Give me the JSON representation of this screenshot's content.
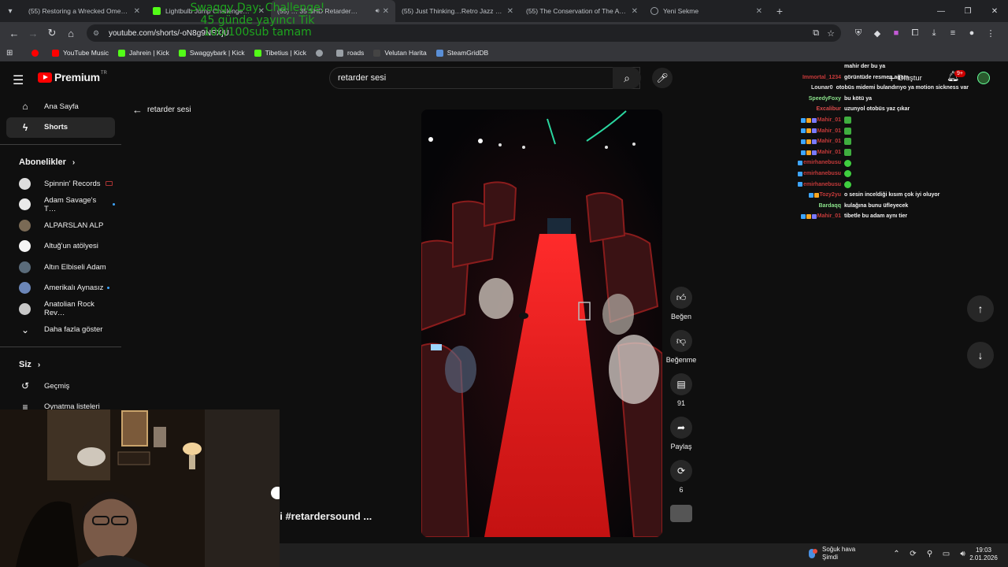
{
  "browser": {
    "tabs": [
      {
        "title": "(55) Restoring a Wrecked Ome…",
        "icon": "youtube",
        "active": false
      },
      {
        "title": "Lightbulb Jump Challenge…",
        "icon": "kick",
        "active": false
      },
      {
        "title": "(55) … 35 SHD Retarder…",
        "icon": "youtube",
        "active": true,
        "audio": true
      },
      {
        "title": "(55) Just Thinking…Retro Jazz …",
        "icon": "youtube",
        "active": false
      },
      {
        "title": "(55) The Conservation of The A…",
        "icon": "youtube",
        "active": false
      },
      {
        "title": "Yeni Sekme",
        "icon": "globe",
        "active": false
      }
    ],
    "url": "youtube.com/shorts/-oN8g9NSXjU",
    "bookmarks": [
      {
        "label": "YouTube Music",
        "color": "#ff0000"
      },
      {
        "label": "Jahrein | Kick",
        "color": "#53fc18"
      },
      {
        "label": "Swaggybark | Kick",
        "color": "#53fc18"
      },
      {
        "label": "Tibetius | Kick",
        "color": "#53fc18"
      },
      {
        "label": "",
        "color": "#9aa0a6"
      },
      {
        "label": "roads",
        "color": "#9aa0a6"
      },
      {
        "label": "Velutan Harita",
        "color": "#444444"
      },
      {
        "label": "SteamGridDB",
        "color": "#5a8fd6"
      }
    ]
  },
  "overlay": {
    "line1": "Swaggy Day: Challenge!",
    "line2": "45 günde yayıncı Tik",
    "line3": "100/100sub tamam"
  },
  "yt": {
    "brand": "Premium",
    "brand_sup": "TR",
    "search_query": "retarder sesi",
    "create_label": "Oluştur",
    "notif_count": "9+",
    "back_label": "retarder sesi",
    "sidebar": {
      "home": "Ana Sayfa",
      "shorts": "Shorts",
      "subs_header": "Abonelikler",
      "subs": [
        {
          "label": "Spinnin' Records",
          "color": "#dddddd",
          "extra": "live"
        },
        {
          "label": "Adam Savage's T…",
          "color": "#e9e9e9",
          "extra": "dot"
        },
        {
          "label": "ALPARSLAN ALP",
          "color": "#7a6a55",
          "extra": ""
        },
        {
          "label": "Altuğ'un atölyesi",
          "color": "#f5f5f5",
          "extra": ""
        },
        {
          "label": "Altın Elbiseli Adam",
          "color": "#5a6b7a",
          "extra": ""
        },
        {
          "label": "Amerikalı Aynasız",
          "color": "#6b86b8",
          "extra": "dot"
        },
        {
          "label": "Anatolian Rock Rev…",
          "color": "#c7c7c7",
          "extra": ""
        }
      ],
      "more": "Daha fazla göster",
      "you_header": "Siz",
      "history": "Geçmiş",
      "playlists": "Oynatma listeleri"
    },
    "actions": {
      "like": "Beğen",
      "dislike": "Beğenme",
      "comments": "91",
      "share": "Paylaş",
      "remix": "6"
    },
    "short_title": "si #retardersound ..."
  },
  "chat": [
    {
      "name": "",
      "name_color": "#e43c3c",
      "badges": [],
      "msg": "mahir der bu ya"
    },
    {
      "name": "Immortal_1234",
      "name_color": "#c93a3a",
      "badges": [],
      "msg": "görüntüde resmen ağam"
    },
    {
      "name": "Lounar0",
      "name_color": "#e0e0e0",
      "badges": [],
      "msg": "otobüs midemi bulandırıyo ya motion sickness var"
    },
    {
      "name": "SpeedyFoxy",
      "name_color": "#8ae08a",
      "badges": [],
      "msg": "bu kötü ya"
    },
    {
      "name": "Excalibur",
      "name_color": "#d74a4a",
      "badges": [],
      "msg": "uzunyol otobüs yaz çıkar"
    },
    {
      "name": "Mahir_01",
      "name_color": "#c43a3a",
      "badges": [
        "#3ea6ff",
        "#f5a623",
        "#7a7aff"
      ],
      "msg": "",
      "emote": "square"
    },
    {
      "name": "Mahir_01",
      "name_color": "#c43a3a",
      "badges": [
        "#3ea6ff",
        "#f5a623",
        "#7a7aff"
      ],
      "msg": "",
      "emote": "square"
    },
    {
      "name": "Mahir_01",
      "name_color": "#c43a3a",
      "badges": [
        "#3ea6ff",
        "#f5a623",
        "#7a7aff"
      ],
      "msg": "",
      "emote": "square"
    },
    {
      "name": "Mahir_01",
      "name_color": "#c43a3a",
      "badges": [
        "#3ea6ff",
        "#f5a623",
        "#7a7aff"
      ],
      "msg": "",
      "emote": "square"
    },
    {
      "name": "emirhanebusu",
      "name_color": "#c43a3a",
      "badges": [
        "#3ea6ff"
      ],
      "msg": "",
      "emote": "round"
    },
    {
      "name": "emirhanebusu",
      "name_color": "#c43a3a",
      "badges": [
        "#3ea6ff"
      ],
      "msg": "",
      "emote": "round"
    },
    {
      "name": "emirhanebusu",
      "name_color": "#c43a3a",
      "badges": [
        "#3ea6ff"
      ],
      "msg": "",
      "emote": "round"
    },
    {
      "name": "Tozy2yu",
      "name_color": "#c43a3a",
      "badges": [
        "#3ea6ff",
        "#f5a623"
      ],
      "msg": "o sesin inceldiği kısım çok iyi oluyor"
    },
    {
      "name": "Bardaqq",
      "name_color": "#8ae08a",
      "badges": [],
      "msg": "kulağına bunu üfleyecek"
    },
    {
      "name": "Mahir_01",
      "name_color": "#c43a3a",
      "badges": [
        "#3ea6ff",
        "#f5a623",
        "#7a7aff"
      ],
      "msg": "tibetle bu adam aynı tier"
    }
  ],
  "taskbar": {
    "weather_title": "Soğuk hava",
    "weather_sub": "Şimdi",
    "time": "19:03",
    "date": "2.01.2026"
  }
}
